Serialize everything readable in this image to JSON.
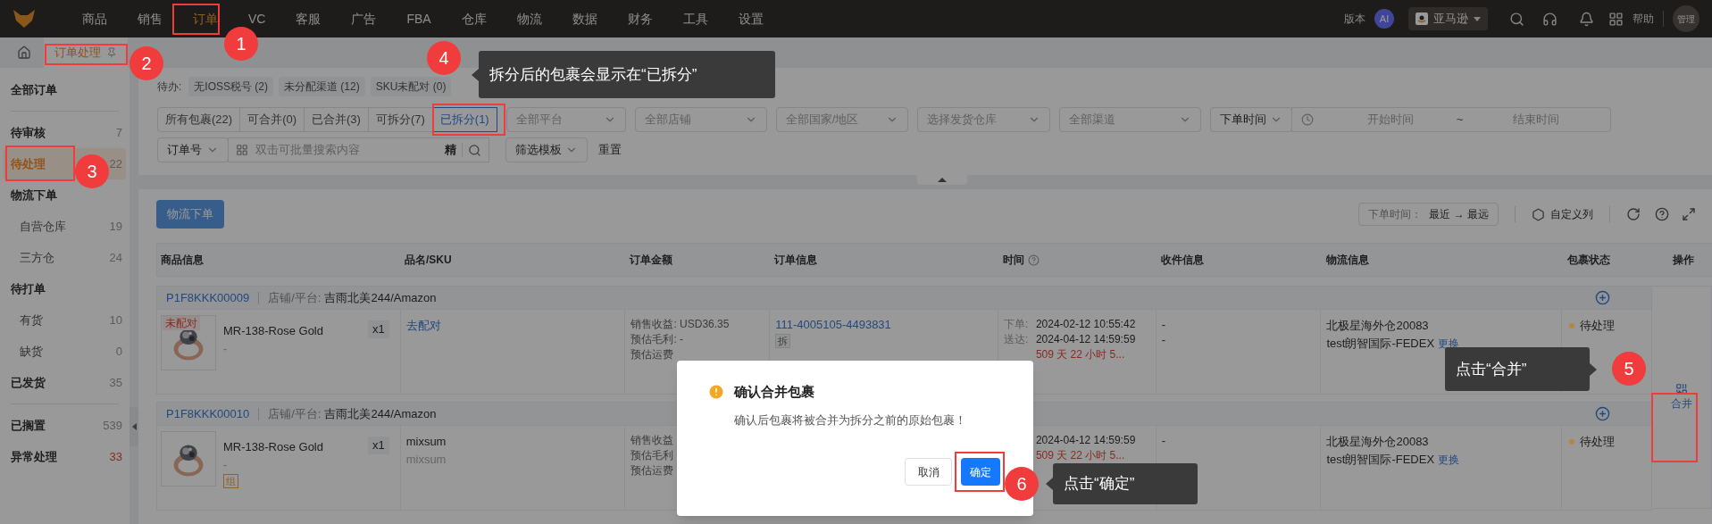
{
  "nav": {
    "items": [
      {
        "label": "商品",
        "selected": false
      },
      {
        "label": "销售",
        "selected": false
      },
      {
        "label": "订单",
        "selected": true
      },
      {
        "label": "VC",
        "selected": false
      },
      {
        "label": "客服",
        "selected": false
      },
      {
        "label": "广告",
        "selected": false
      },
      {
        "label": "FBA",
        "selected": false
      },
      {
        "label": "仓库",
        "selected": false
      },
      {
        "label": "物流",
        "selected": false
      },
      {
        "label": "数据",
        "selected": false
      },
      {
        "label": "财务",
        "selected": false
      },
      {
        "label": "工具",
        "selected": false
      },
      {
        "label": "设置",
        "selected": false
      }
    ],
    "version": "版本",
    "ai_badge": "AI",
    "store_select": "亚马逊",
    "help": "帮助",
    "avatar": "管理"
  },
  "page_tabs": [
    {
      "label": "订单处理",
      "selected": true
    }
  ],
  "sidebar": {
    "sections": [
      {
        "items": [
          {
            "label": "全部订单",
            "selected": false
          }
        ]
      },
      {
        "items": [
          {
            "label": "待审核",
            "count": {
              "text": "7",
              "alert": false
            },
            "selected": false
          },
          {
            "label": "待处理",
            "count": {
              "text": "22",
              "alert": false
            },
            "selected": true
          },
          {
            "label": "物流下单",
            "selected": false,
            "children": [
              {
                "label": "自营仓库",
                "count": "19",
                "selected": false
              },
              {
                "label": "三方仓",
                "count": "24",
                "selected": false
              }
            ]
          },
          {
            "label": "待打单",
            "selected": false,
            "children": [
              {
                "label": "有货",
                "count": "10",
                "selected": false
              },
              {
                "label": "缺货",
                "count": "0",
                "selected": false
              }
            ]
          },
          {
            "label": "已发货",
            "count": {
              "text": "35",
              "alert": false
            },
            "selected": false
          }
        ]
      },
      {
        "items": [
          {
            "label": "已搁置",
            "count": {
              "text": "539",
              "alert": false
            },
            "selected": false
          },
          {
            "label": "异常处理",
            "count": {
              "text": "33",
              "alert": true
            },
            "selected": false
          }
        ]
      }
    ]
  },
  "todo": {
    "label": "待办:",
    "chips": [
      "无IOSS税号 (2)",
      "未分配渠道 (12)",
      "SKU未配对 (0)"
    ]
  },
  "status_tabs": [
    {
      "label": "所有包裹(22)",
      "selected": false
    },
    {
      "label": "可合并(0)",
      "selected": false
    },
    {
      "label": "已合并(3)",
      "selected": false
    },
    {
      "label": "可拆分(7)",
      "selected": false
    },
    {
      "label": "已拆分(1)",
      "selected": true
    }
  ],
  "filters": [
    {
      "placeholder": "全部平台"
    },
    {
      "placeholder": "全部店铺"
    },
    {
      "placeholder": "全部国家/地区"
    },
    {
      "placeholder": "选择发货仓库"
    },
    {
      "placeholder": "全部渠道"
    }
  ],
  "date_filter": {
    "type": "下单时间",
    "start_placeholder": "开始时间",
    "separator": "~",
    "end_placeholder": "结束时间"
  },
  "search": {
    "field": "订单号",
    "placeholder": "双击可批量搜索内容",
    "exact": "精",
    "template": "筛选模板",
    "reset": "重置"
  },
  "toolbar": {
    "logistics_button": {
      "label": "物流下单",
      "disabled": true
    },
    "sort_label": "下单时间：",
    "sort_value": "最近 → 最远",
    "custom_columns": "自定义列"
  },
  "table": {
    "columns": [
      {
        "label": "商品信息",
        "help": false
      },
      {
        "label": "品名/SKU",
        "help": false
      },
      {
        "label": "订单金额",
        "help": false
      },
      {
        "label": "订单信息",
        "help": false
      },
      {
        "label": "时间",
        "help": true
      },
      {
        "label": "收件信息",
        "help": false
      },
      {
        "label": "物流信息",
        "help": false
      },
      {
        "label": "包裹状态",
        "help": false
      },
      {
        "label": "操作",
        "help": false
      }
    ],
    "groups": [
      {
        "package_id": "P1F8KKK00009",
        "store_label": "店铺/平台:",
        "store": "吉雨北美244/Amazon",
        "product": {
          "name": "MR-138-Rose Gold",
          "sub": "-",
          "qty": "x1",
          "badge": "未配对"
        },
        "sku": [
          {
            "text": "去配对",
            "kind": "link"
          }
        ],
        "amount": [
          "销售收益: USD36.35",
          "预估毛利: -",
          "预估运费"
        ],
        "order": {
          "id": "111-4005105-4493831",
          "tag": "拆"
        },
        "time": {
          "lines": [
            {
              "label": "下单:",
              "value": "2024-02-12 10:55:42"
            },
            {
              "label": "送达:",
              "value": "2024-04-12 14:59:59"
            }
          ],
          "remaining": "509 天 22 小时 5..."
        },
        "recipient": [
          "-",
          "-"
        ],
        "logistics": {
          "warehouse": "北极星海外仓20083",
          "carrier": "test朗智国际-FEDEX",
          "change": "更换"
        },
        "status": {
          "label": "待处理",
          "color": "#b8843e"
        }
      },
      {
        "package_id": "P1F8KKK00010",
        "store_label": "店铺/平台:",
        "store": "吉雨北美244/Amazon",
        "product": {
          "name": "MR-138-Rose Gold",
          "sub": "-",
          "qty": "x1",
          "tag": "组"
        },
        "sku": [
          {
            "text": "mixsum",
            "kind": "primary"
          },
          {
            "text": "mixsum",
            "kind": "secondary"
          }
        ],
        "amount": [
          "销售收益",
          "预估毛利",
          "预估运费"
        ],
        "time": {
          "lines": [
            {
              "value": "2024-04-12 14:59:59"
            }
          ],
          "remaining": "509 天 22 小时 5..."
        },
        "recipient": [
          "-"
        ],
        "logistics": {
          "warehouse": "北极星海外仓20083",
          "carrier": "test朗智国际-FEDEX",
          "change": "更换"
        },
        "status": {
          "label": "待处理",
          "color": "#b8843e"
        }
      }
    ],
    "action": "合并"
  },
  "modal": {
    "title": "确认合并包裹",
    "message": "确认后包裹将被合并为拆分之前的原始包裹！",
    "buttons": [
      {
        "label": "取消",
        "kind": "secondary"
      },
      {
        "label": "确定",
        "kind": "primary"
      }
    ]
  },
  "annotations": [
    {
      "number": "1"
    },
    {
      "number": "2"
    },
    {
      "number": "3"
    },
    {
      "number": "4",
      "tip": "拆分后的包裹会显示在“已拆分”"
    },
    {
      "number": "5",
      "tip": "点击“合并”"
    },
    {
      "number": "6",
      "tip": "点击“确定”"
    }
  ]
}
